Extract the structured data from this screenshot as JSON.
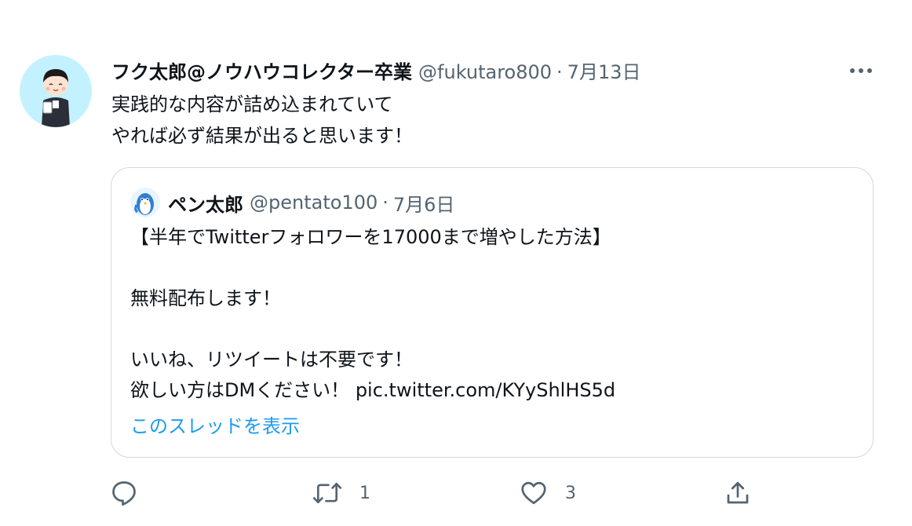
{
  "tweet": {
    "author_name": "フク太郎@ノウハウコレクター卒業",
    "author_handle": "@fukutaro800",
    "separator": "·",
    "date": "7月13日",
    "text_lines": [
      "実践的な内容が詰め込まれていて",
      "やれば必ず結果が出ると思います！"
    ]
  },
  "quote": {
    "author_name": "ペン太郎",
    "author_handle": "@pentato100",
    "separator": "·",
    "date": "7月6日",
    "text_lines": [
      "【半年でTwitterフォロワーを17000まで増やした方法】",
      "",
      "無料配布します！",
      "",
      "いいね、リツイートは不要です！",
      "欲しい方はDMください！ pic.twitter.com/KYyShlHS5d"
    ],
    "thread_link": "このスレッドを表示"
  },
  "actions": {
    "reply_icon": "reply-icon",
    "retweet_icon": "retweet-icon",
    "retweet_count": "1",
    "like_icon": "heart-icon",
    "like_count": "3",
    "share_icon": "share-icon"
  },
  "colors": {
    "text": "#0f1419",
    "muted": "#536471",
    "link": "#1d9bf0",
    "border": "#cfd9de",
    "avatar_bg": "#c4f1ff"
  }
}
